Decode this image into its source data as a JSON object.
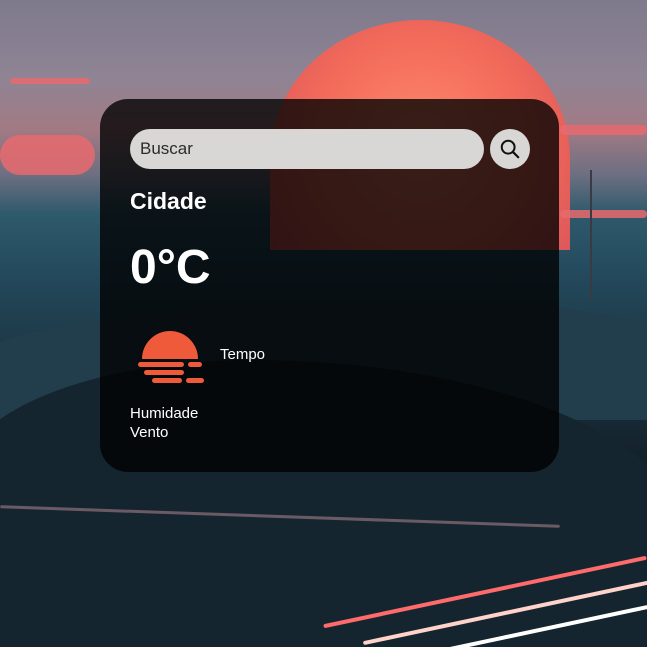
{
  "search": {
    "placeholder": "Buscar",
    "value": ""
  },
  "weather": {
    "city": "Cidade",
    "temperature": "0°C",
    "description": "Tempo",
    "humidity_label": "Humidade",
    "wind_label": "Vento",
    "icon": "sun-haze-icon"
  },
  "colors": {
    "card_background": "rgba(0,0,0,0.78)",
    "input_background": "#d9d7d6",
    "icon_color": "#ee5a3a",
    "text_color": "#ffffff"
  }
}
